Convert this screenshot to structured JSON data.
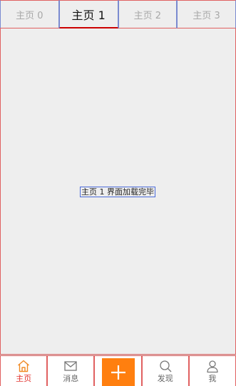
{
  "top_tabs": [
    {
      "label": "主页 0",
      "active": false
    },
    {
      "label": "主页 1",
      "active": true
    },
    {
      "label": "主页 2",
      "active": false
    },
    {
      "label": "主页 3",
      "active": false
    }
  ],
  "content": {
    "message": "主页 1 界面加载完毕"
  },
  "bottom_nav": [
    {
      "label": "主页",
      "icon": "home-icon",
      "active": true
    },
    {
      "label": "消息",
      "icon": "mail-icon",
      "active": false
    },
    {
      "label": "",
      "icon": "plus-icon",
      "active": false
    },
    {
      "label": "发现",
      "icon": "search-icon",
      "active": false
    },
    {
      "label": "我",
      "icon": "person-icon",
      "active": false
    }
  ],
  "colors": {
    "accent": "#ff7f0f",
    "active_nav": "#e0302c",
    "active_tab_underline": "#cc0000",
    "background": "#eeeeee"
  }
}
